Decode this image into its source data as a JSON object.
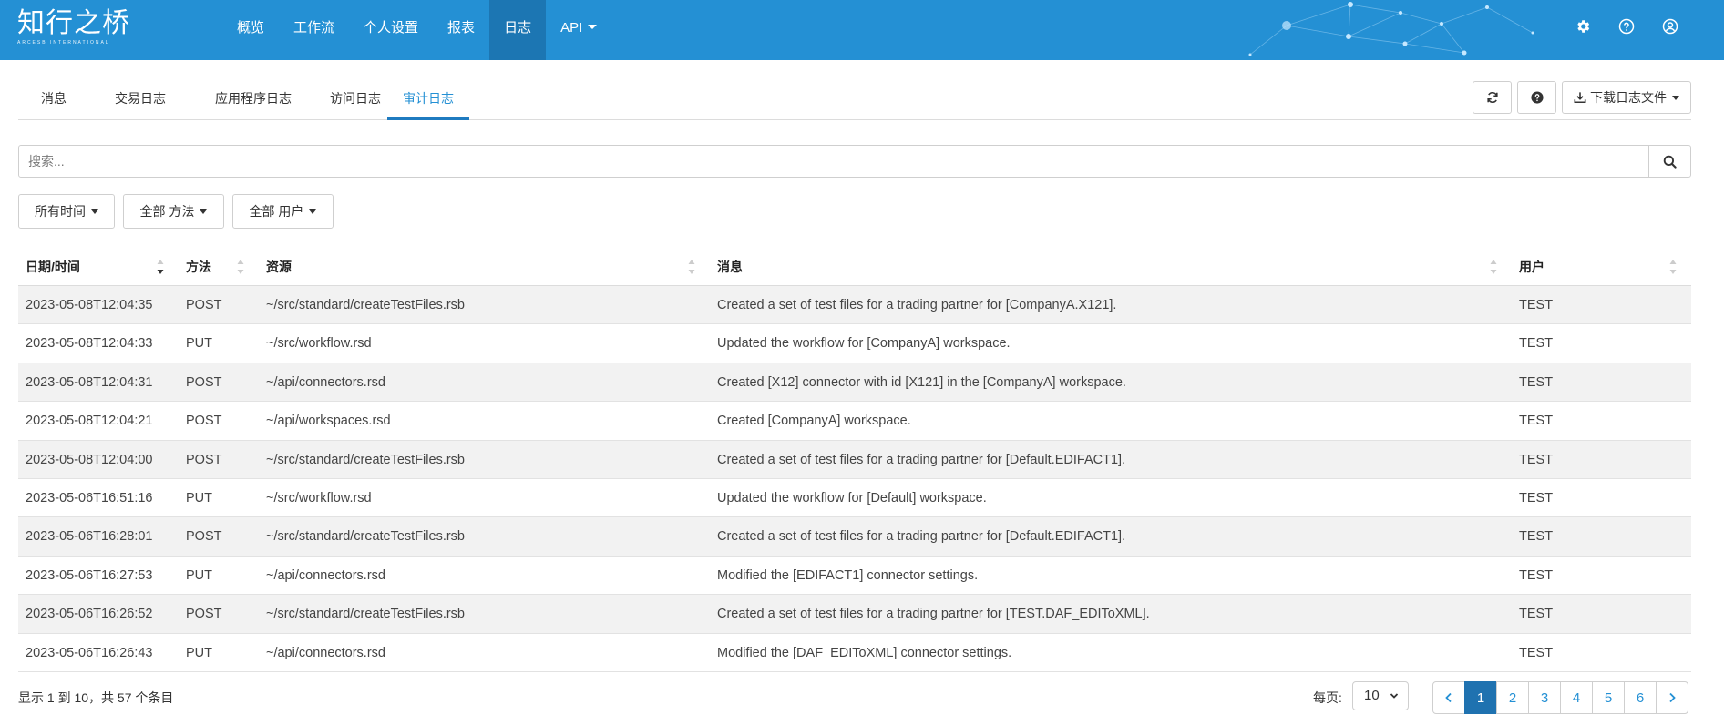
{
  "brand": {
    "logo_text": "知行之桥",
    "logo_sub": "ARCESB INTERNATIONAL"
  },
  "nav": {
    "items": [
      {
        "label": "概览"
      },
      {
        "label": "工作流"
      },
      {
        "label": "个人设置"
      },
      {
        "label": "报表"
      },
      {
        "label": "日志",
        "active": true
      },
      {
        "label": "API",
        "dropdown": true
      }
    ],
    "icons": [
      "gear-icon",
      "help-circle-icon",
      "user-circle-icon"
    ]
  },
  "tabs": {
    "items": [
      {
        "label": "消息"
      },
      {
        "label": "交易日志"
      },
      {
        "label": "应用程序日志"
      },
      {
        "label": "访问日志"
      },
      {
        "label": "审计日志",
        "active": true
      }
    ]
  },
  "toolbar": {
    "refresh_icon": "refresh-icon",
    "help_icon": "question-icon",
    "download_label": "下载日志文件"
  },
  "search": {
    "placeholder": "搜索..."
  },
  "filters": {
    "time": "所有时间",
    "method": "全部 方法",
    "user": "全部 用户"
  },
  "table": {
    "headers": {
      "date": "日期/时间",
      "method": "方法",
      "resource": "资源",
      "message": "消息",
      "user": "用户"
    },
    "rows": [
      {
        "date": "2023-05-08T12:04:35",
        "method": "POST",
        "resource": "~/src/standard/createTestFiles.rsb",
        "message": "Created a set of test files for a trading partner for [CompanyA.X121].",
        "user": "TEST"
      },
      {
        "date": "2023-05-08T12:04:33",
        "method": "PUT",
        "resource": "~/src/workflow.rsd",
        "message": "Updated the workflow for [CompanyA] workspace.",
        "user": "TEST"
      },
      {
        "date": "2023-05-08T12:04:31",
        "method": "POST",
        "resource": "~/api/connectors.rsd",
        "message": "Created [X12] connector with id [X121] in the [CompanyA] workspace.",
        "user": "TEST"
      },
      {
        "date": "2023-05-08T12:04:21",
        "method": "POST",
        "resource": "~/api/workspaces.rsd",
        "message": "Created [CompanyA] workspace.",
        "user": "TEST"
      },
      {
        "date": "2023-05-08T12:04:00",
        "method": "POST",
        "resource": "~/src/standard/createTestFiles.rsb",
        "message": "Created a set of test files for a trading partner for [Default.EDIFACT1].",
        "user": "TEST"
      },
      {
        "date": "2023-05-06T16:51:16",
        "method": "PUT",
        "resource": "~/src/workflow.rsd",
        "message": "Updated the workflow for [Default] workspace.",
        "user": "TEST"
      },
      {
        "date": "2023-05-06T16:28:01",
        "method": "POST",
        "resource": "~/src/standard/createTestFiles.rsb",
        "message": "Created a set of test files for a trading partner for [Default.EDIFACT1].",
        "user": "TEST"
      },
      {
        "date": "2023-05-06T16:27:53",
        "method": "PUT",
        "resource": "~/api/connectors.rsd",
        "message": "Modified the [EDIFACT1] connector settings.",
        "user": "TEST"
      },
      {
        "date": "2023-05-06T16:26:52",
        "method": "POST",
        "resource": "~/src/standard/createTestFiles.rsb",
        "message": "Created a set of test files for a trading partner for [TEST.DAF_EDIToXML].",
        "user": "TEST"
      },
      {
        "date": "2023-05-06T16:26:43",
        "method": "PUT",
        "resource": "~/api/connectors.rsd",
        "message": "Modified the [DAF_EDIToXML] connector settings.",
        "user": "TEST"
      }
    ]
  },
  "footer": {
    "summary": "显示 1 到 10，共 57 个条目",
    "per_page_label": "每页:",
    "per_page_value": "10",
    "pages": [
      "1",
      "2",
      "3",
      "4",
      "5",
      "6"
    ],
    "current_page": "1"
  },
  "colors": {
    "navbar": "#2490d4",
    "nav_active": "#1c76b3",
    "accent": "#2490d4",
    "page_active": "#1f72b0",
    "row_stripe": "#f2f2f2"
  }
}
